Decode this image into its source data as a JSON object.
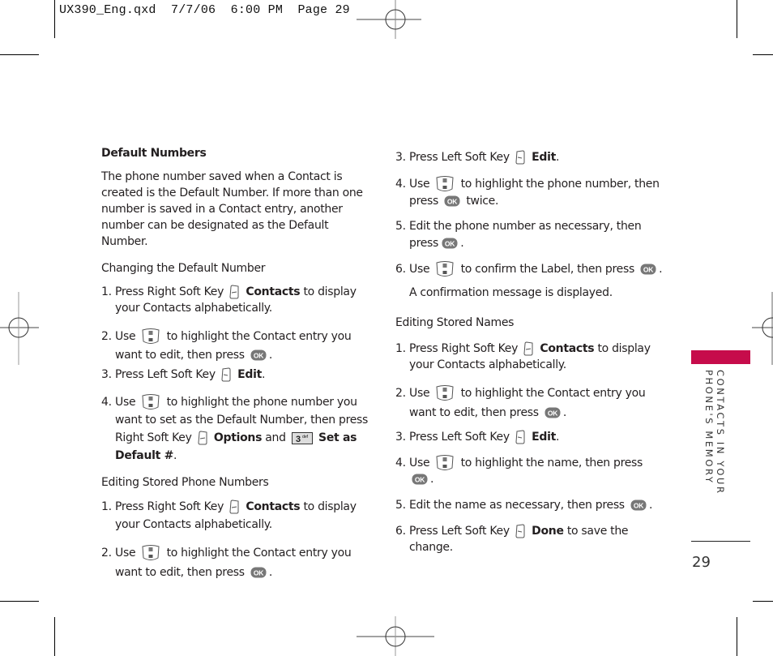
{
  "slug": "UX390_Eng.qxd  7/7/06  6:00 PM  Page 29",
  "left_column": {
    "default_heading": "Default Numbers",
    "default_para": "The phone number saved when a Contact is created is the Default Number. If more than one number is saved in a Contact entry, another number can be designated as the Default Number.",
    "changing_heading": "Changing the Default Number",
    "changing_steps": [
      {
        "num": "1.",
        "a": "Press Right Soft Key",
        "icon": "right-soft-key-icon",
        "bold": "Contacts",
        "b": "to display your Contacts alphabetically."
      },
      {
        "num": "2.",
        "a": "Use",
        "icon": "nav-key-icon",
        "b": "to highlight the Contact entry you want to edit, then press",
        "icon2": "ok-key-icon",
        "c": "."
      },
      {
        "num": "3.",
        "a": "Press Left Soft Key",
        "icon": "left-soft-key-icon",
        "bold": "Edit",
        "b": "."
      },
      {
        "num": "4.",
        "a": "Use",
        "icon": "nav-key-icon",
        "b": "to highlight the phone number you want to set as the Default Number, then press  Right Soft Key",
        "icon2": "right-soft-key-icon",
        "bold": "Options",
        "c": "and",
        "icon3": "key-3-def-icon",
        "bold2": "Set as Default #",
        "d": "."
      }
    ],
    "editing_numbers_heading": "Editing Stored Phone Numbers",
    "editing_numbers_steps": [
      {
        "num": "1.",
        "a": "Press Right Soft Key",
        "bold": "Contacts",
        "b": "to display your Contacts alphabetically."
      },
      {
        "num": "2.",
        "a": "Use",
        "b": "to highlight the Contact entry you want to edit, then press",
        "c": "."
      }
    ]
  },
  "right_column": {
    "editing_numbers_steps_cont": [
      {
        "num": "3.",
        "a": "Press Left Soft Key",
        "bold": "Edit",
        "b": "."
      },
      {
        "num": "4.",
        "a": "Use",
        "b": "to highlight the phone number, then press",
        "c": "twice."
      },
      {
        "num": "5.",
        "a": "Edit the phone number as necessary, then press",
        "c": "."
      },
      {
        "num": "6.",
        "a": "Use",
        "b": "to confirm the Label, then press",
        "c": "."
      }
    ],
    "confirmation_note": "A confirmation message is displayed.",
    "editing_names_heading": "Editing Stored Names",
    "editing_names_steps": [
      {
        "num": "1.",
        "a": "Press Right Soft Key",
        "bold": "Contacts",
        "b": "to display your Contacts alphabetically."
      },
      {
        "num": "2.",
        "a": "Use",
        "b": "to highlight the Contact entry you want to edit, then press",
        "c": "."
      },
      {
        "num": "3.",
        "a": "Press Left Soft Key",
        "bold": "Edit",
        "b": "."
      },
      {
        "num": "4.",
        "a": "Use",
        "b": "to highlight the name, then press",
        "c": "."
      },
      {
        "num": "5.",
        "a": "Edit the name as necessary, then press",
        "c": "."
      },
      {
        "num": "6.",
        "a": "Press Left Soft Key",
        "bold": "Done",
        "b": "to save the change."
      }
    ]
  },
  "sidebar": {
    "section_label": "CONTACTS IN YOUR PHONE'S MEMORY",
    "accent_color": "#c60c4b"
  },
  "footer": {
    "page_number": "29"
  },
  "icons": {
    "key_3_label": "3",
    "key_3_letters": "def",
    "ok_label": "OK"
  }
}
